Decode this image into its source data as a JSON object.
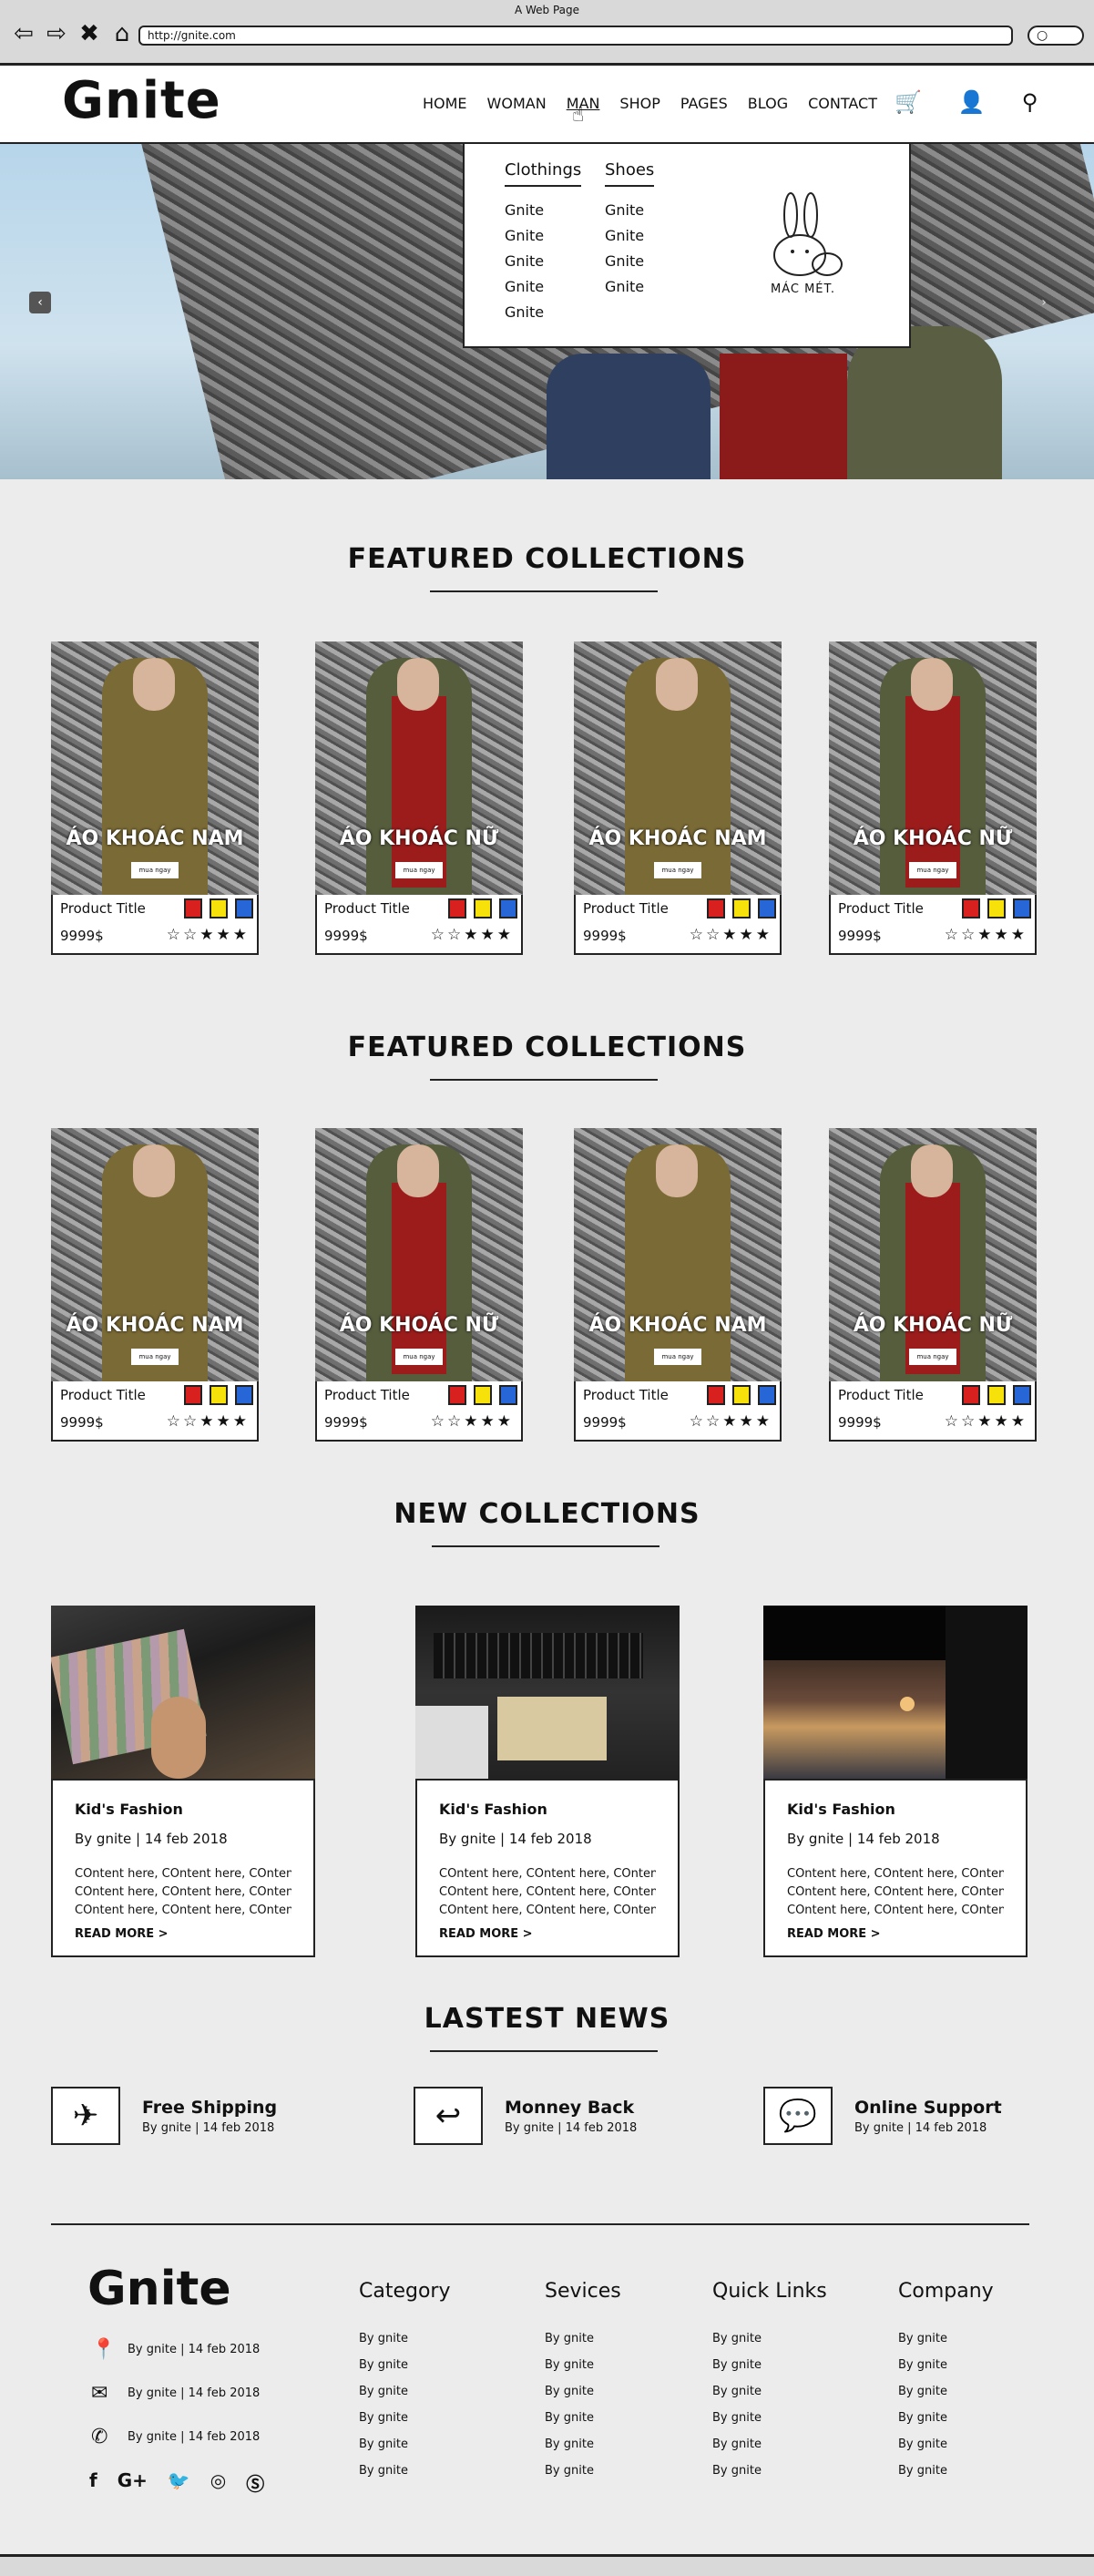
{
  "browser": {
    "window_title": "A Web Page",
    "url": "http://gnite.com"
  },
  "header": {
    "logo": "Gnite",
    "menu": [
      "HOME",
      "WOMAN",
      "MAN",
      "SHOP",
      "PAGES",
      "BLOG",
      "CONTACT"
    ],
    "active_menu": "MAN"
  },
  "dropdown": {
    "col1": {
      "heading": "Clothings",
      "links": [
        "Gnite",
        "Gnite",
        "Gnite",
        "Gnite",
        "Gnite"
      ]
    },
    "col2": {
      "heading": "Shoes",
      "links": [
        "Gnite",
        "Gnite",
        "Gnite",
        "Gnite"
      ]
    },
    "promo_label": "MÁC MÉT."
  },
  "featured_1": {
    "title": "FEATURED COLLECTIONS",
    "products": [
      {
        "image_title": "ÁO KHOÁC NAM",
        "button": "mua ngay",
        "title": "Product Title",
        "price": "9999$"
      },
      {
        "image_title": "ÁO KHOÁC NỮ",
        "button": "mua ngay",
        "title": "Product Title",
        "price": "9999$"
      },
      {
        "image_title": "ÁO KHOÁC NAM",
        "button": "mua ngay",
        "title": "Product Title",
        "price": "9999$"
      },
      {
        "image_title": "ÁO KHOÁC NỮ",
        "button": "mua ngay",
        "title": "Product Title",
        "price": "9999$"
      }
    ]
  },
  "featured_2": {
    "title": "FEATURED COLLECTIONS",
    "products": [
      {
        "image_title": "ÁO KHOÁC NAM",
        "button": "mua ngay",
        "title": "Product Title",
        "price": "9999$"
      },
      {
        "image_title": "ÁO KHOÁC NỮ",
        "button": "mua ngay",
        "title": "Product Title",
        "price": "9999$"
      },
      {
        "image_title": "ÁO KHOÁC NAM",
        "button": "mua ngay",
        "title": "Product Title",
        "price": "9999$"
      },
      {
        "image_title": "ÁO KHOÁC NỮ",
        "button": "mua ngay",
        "title": "Product Title",
        "price": "9999$"
      }
    ]
  },
  "swatch_colors": [
    "#d8201e",
    "#f7e10a",
    "#2766d6"
  ],
  "stars_text": "☆☆★★★",
  "new_collections": {
    "title": "NEW COLLECTIONS",
    "cards": [
      {
        "title": "Kid's Fashion",
        "meta": "By gnite | 14 feb 2018",
        "lines": [
          "COntent here, COntent here, COntent here",
          "COntent here, COntent here, COntent here",
          "COntent here, COntent here, COntent here"
        ],
        "read_more": "READ MORE >"
      },
      {
        "title": "Kid's Fashion",
        "meta": "By gnite | 14 feb 2018",
        "lines": [
          "COntent here, COntent here, COntent here",
          "COntent here, COntent here, COntent here",
          "COntent here, COntent here, COntent here"
        ],
        "read_more": "READ MORE >"
      },
      {
        "title": "Kid's Fashion",
        "meta": "By gnite | 14 feb 2018",
        "lines": [
          "COntent here, COntent here, COntent here",
          "COntent here, COntent here, COntent here",
          "COntent here, COntent here, COntent here"
        ],
        "read_more": "READ MORE >"
      }
    ]
  },
  "latest_news": {
    "title": "LASTEST NEWS",
    "items": [
      {
        "title": "Free Shipping",
        "meta": "By gnite | 14 feb 2018",
        "icon": "airplane-icon"
      },
      {
        "title": "Monney Back",
        "meta": "By gnite | 14 feb 2018",
        "icon": "reply-icon"
      },
      {
        "title": "Online Support",
        "meta": "By gnite | 14 feb 2018",
        "icon": "chat-icon"
      }
    ]
  },
  "footer": {
    "logo": "Gnite",
    "contacts": [
      {
        "icon": "location-icon",
        "text": "By gnite | 14 feb 2018"
      },
      {
        "icon": "mail-icon",
        "text": "By gnite | 14 feb 2018"
      },
      {
        "icon": "phone-icon",
        "text": "By gnite | 14 feb 2018"
      }
    ],
    "social": [
      "facebook-icon",
      "google-plus-icon",
      "twitter-icon",
      "instagram-icon",
      "skype-icon"
    ],
    "columns": [
      {
        "heading": "Category",
        "links": [
          "By gnite",
          "By gnite",
          "By gnite",
          "By gnite",
          "By gnite",
          "By gnite"
        ]
      },
      {
        "heading": "Sevices",
        "links": [
          "By gnite",
          "By gnite",
          "By gnite",
          "By gnite",
          "By gnite",
          "By gnite"
        ]
      },
      {
        "heading": "Quick Links",
        "links": [
          "By gnite",
          "By gnite",
          "By gnite",
          "By gnite",
          "By gnite",
          "By gnite"
        ]
      },
      {
        "heading": "Company",
        "links": [
          "By gnite",
          "By gnite",
          "By gnite",
          "By gnite",
          "By gnite",
          "By gnite"
        ]
      }
    ]
  }
}
